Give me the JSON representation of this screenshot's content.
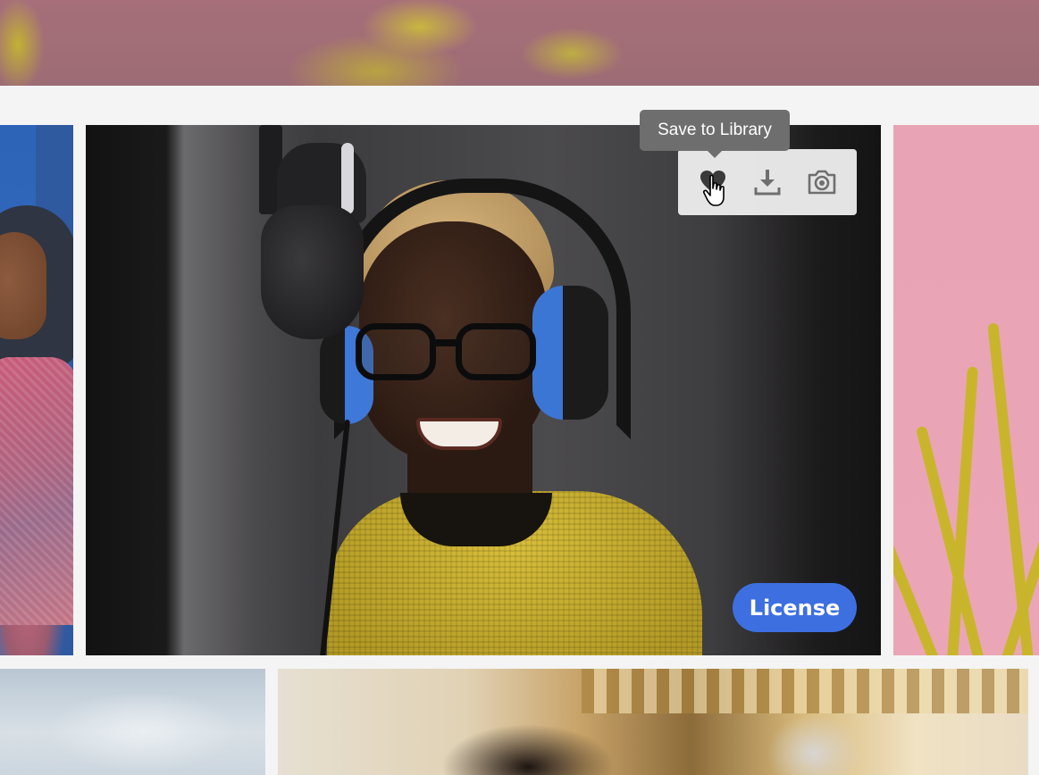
{
  "main_card": {
    "tooltip_text": "Save to Library",
    "actions": [
      {
        "id": "save",
        "icon": "heart-icon"
      },
      {
        "id": "download",
        "icon": "download-icon"
      },
      {
        "id": "similar",
        "icon": "camera-icon"
      }
    ],
    "license_label": "License",
    "colors": {
      "license_button": "#3d6fe0",
      "tooltip_bg": "#6e6e6e",
      "toolbar_bg": "#ececec",
      "icon": "#6f6f6f",
      "page_bg": "#f4f4f4"
    }
  }
}
